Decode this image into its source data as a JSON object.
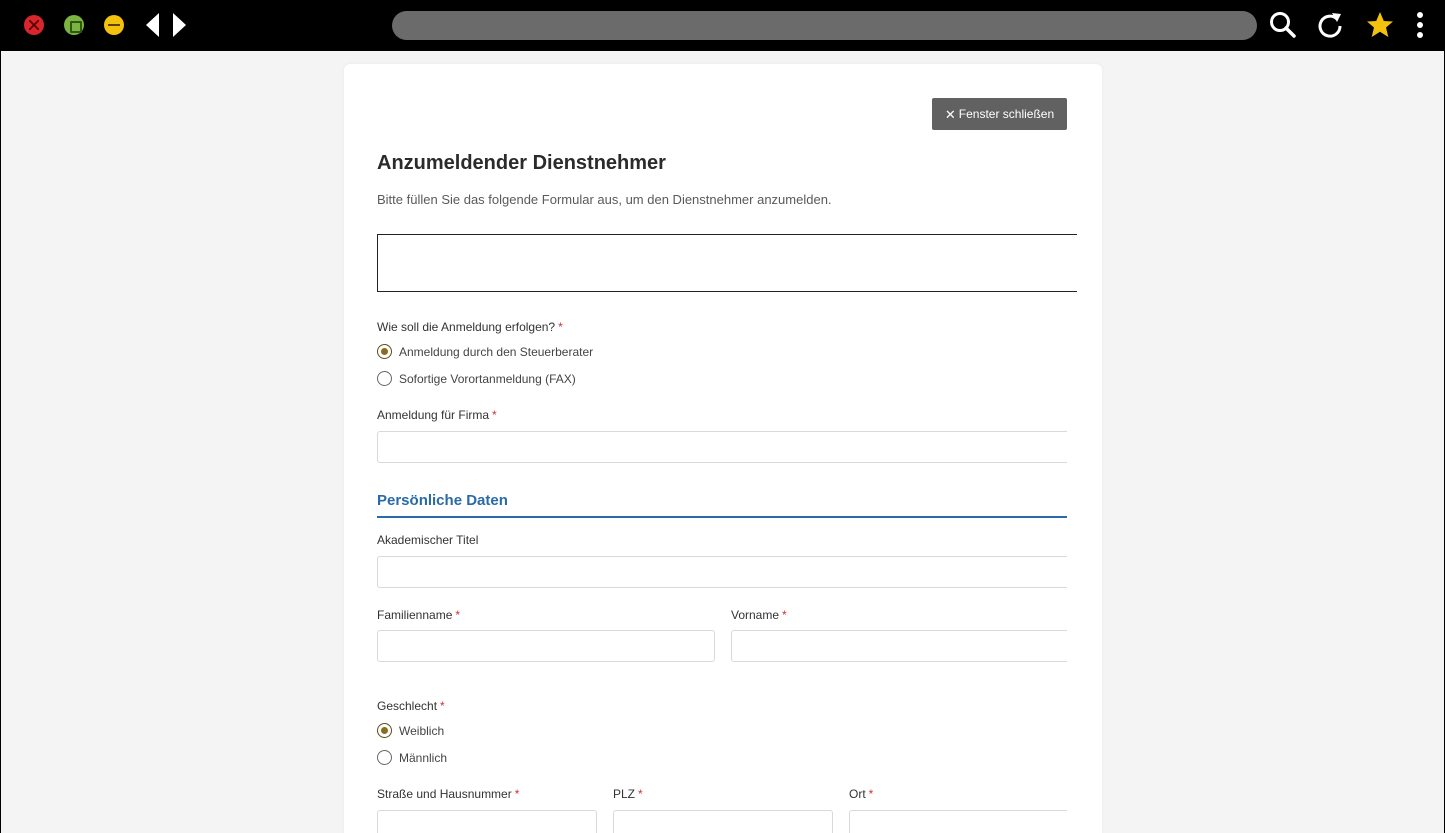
{
  "browser": {
    "icons": [
      "close-window-icon",
      "maximize-icon",
      "minimize-icon",
      "back-arrow-icon",
      "forward-arrow-icon",
      "search-icon",
      "reload-icon",
      "star-icon",
      "menu-icon"
    ],
    "address": ""
  },
  "form": {
    "close_button": "Fenster schließen",
    "close_icon": "✕",
    "title": "Anzumeldender Dienstnehmer",
    "subtitle": "Bitte füllen Sie das folgende Formular aus, um den Dienstnehmer anzumelden.",
    "registration": {
      "label": "Wie soll die Anmeldung erfolgen?",
      "required_mark": "*",
      "options": [
        {
          "label": "Anmeldung durch den Steuerberater",
          "selected": true
        },
        {
          "label": "Sofortige Vorortanmeldung (FAX)",
          "selected": false
        }
      ]
    },
    "company": {
      "label": "Anmeldung für Firma",
      "required_mark": "*",
      "value": ""
    },
    "section_personal": "Persönliche Daten",
    "academic_title": {
      "label": "Akademischer Titel",
      "value": ""
    },
    "last_name": {
      "label": "Familienname",
      "required_mark": "*",
      "value": ""
    },
    "first_name": {
      "label": "Vorname",
      "required_mark": "*",
      "value": ""
    },
    "gender": {
      "label": "Geschlecht",
      "required_mark": "*",
      "options": [
        {
          "label": "Weiblich",
          "selected": true
        },
        {
          "label": "Männlich",
          "selected": false
        }
      ]
    },
    "street": {
      "label": "Straße und Hausnummer",
      "required_mark": "*",
      "value": ""
    },
    "zip": {
      "label": "PLZ",
      "required_mark": "*",
      "value": ""
    },
    "city": {
      "label": "Ort",
      "required_mark": "*",
      "value": ""
    }
  },
  "colors": {
    "accent": "#2a6aa6",
    "required": "#d32f2f",
    "button_bg": "#616161",
    "radio_selected": "#8a6d1e"
  }
}
